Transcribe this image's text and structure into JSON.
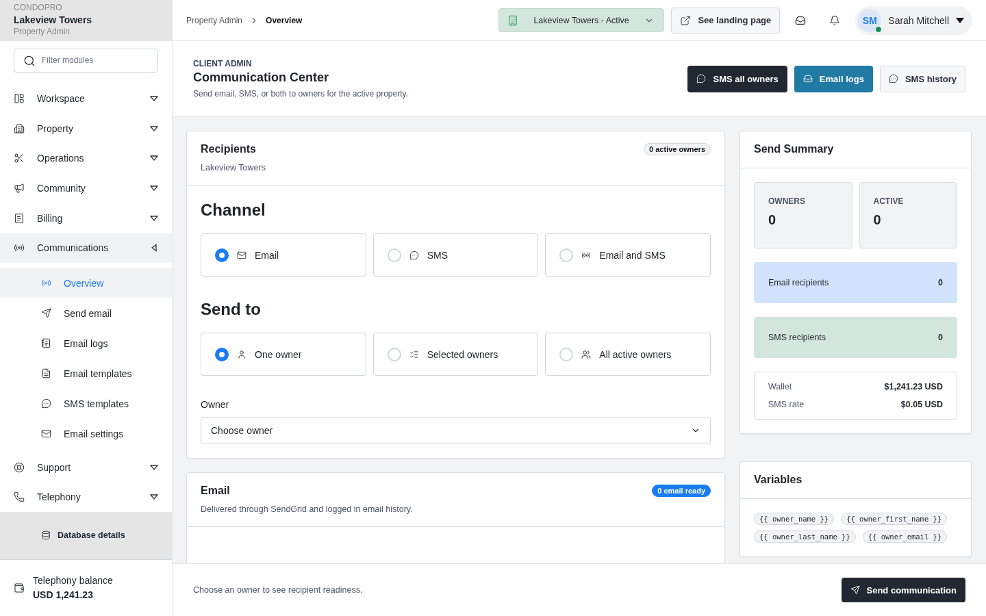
{
  "sidebar": {
    "brand": "CONDOPRO",
    "property": "Lakeview Towers",
    "role": "Property Admin",
    "filter": {
      "placeholder": "Filter modules"
    },
    "items": [
      {
        "label": "Workspace",
        "expanded": false,
        "selected": false
      },
      {
        "label": "Property",
        "expanded": false,
        "selected": false
      },
      {
        "label": "Operations",
        "expanded": false,
        "selected": false
      },
      {
        "label": "Community",
        "expanded": false,
        "selected": false
      },
      {
        "label": "Billing",
        "expanded": false,
        "selected": false
      },
      {
        "label": "Communications",
        "expanded": true,
        "selected": true,
        "children": [
          {
            "label": "Overview",
            "selected": true
          },
          {
            "label": "Send email",
            "selected": false
          },
          {
            "label": "Email logs",
            "selected": false
          },
          {
            "label": "Email templates",
            "selected": false
          },
          {
            "label": "SMS templates",
            "selected": false
          },
          {
            "label": "Email settings",
            "selected": false
          }
        ]
      },
      {
        "label": "Support",
        "expanded": false,
        "selected": false
      },
      {
        "label": "Telephony",
        "expanded": false,
        "selected": false
      }
    ],
    "database_link": "Database details",
    "balance": {
      "label": "Telephony balance",
      "value": "USD 1,241.23"
    }
  },
  "topbar": {
    "breadcrumb": [
      "Property Admin",
      "Overview"
    ],
    "property_select": "Lakeview Towers - Active",
    "landing_button": "See landing page",
    "user": {
      "initials": "SM",
      "name": "Sarah Mitchell",
      "online": true
    }
  },
  "header": {
    "eyebrow": "CLIENT ADMIN",
    "title": "Communication Center",
    "subtitle": "Send email, SMS, or both to owners for the active property.",
    "actions": [
      {
        "label": "SMS all owners",
        "kind": "dark"
      },
      {
        "label": "Email logs",
        "kind": "primary"
      },
      {
        "label": "SMS history",
        "kind": "outline"
      }
    ]
  },
  "recipients": {
    "title": "Recipients",
    "subtitle": "Lakeview Towers",
    "badge": "0 active owners",
    "channel_heading": "Channel",
    "channels": [
      {
        "label": "Email",
        "selected": true
      },
      {
        "label": "SMS",
        "selected": false
      },
      {
        "label": "Email and SMS",
        "selected": false
      }
    ],
    "send_to_heading": "Send to",
    "targets": [
      {
        "label": "One owner",
        "selected": true
      },
      {
        "label": "Selected owners",
        "selected": false
      },
      {
        "label": "All active owners",
        "selected": false
      }
    ],
    "owner": {
      "label": "Owner",
      "value": "Choose owner"
    }
  },
  "email_card": {
    "title": "Email",
    "badge": "0 email ready",
    "subtitle": "Delivered through SendGrid and logged in email history."
  },
  "summary": {
    "title": "Send Summary",
    "stats": [
      {
        "label": "OWNERS",
        "value": "0"
      },
      {
        "label": "ACTIVE",
        "value": "0"
      }
    ],
    "channels": [
      {
        "label": "Email recipients",
        "value": "0",
        "color": "#d1e3fc"
      },
      {
        "label": "SMS recipients",
        "value": "0",
        "color": "#d3e6dd"
      }
    ],
    "rates": [
      {
        "label": "Wallet",
        "value": "$1,241.23 USD"
      },
      {
        "label": "SMS rate",
        "value": "$0.05 USD"
      }
    ]
  },
  "variables": {
    "title": "Variables",
    "chips": [
      "{{ owner_name }}",
      "{{ owner_first_name }}",
      "{{ owner_last_name }}",
      "{{ owner_email }}"
    ]
  },
  "footer": {
    "hint": "Choose an owner to see recipient readiness.",
    "button": "Send communication"
  }
}
